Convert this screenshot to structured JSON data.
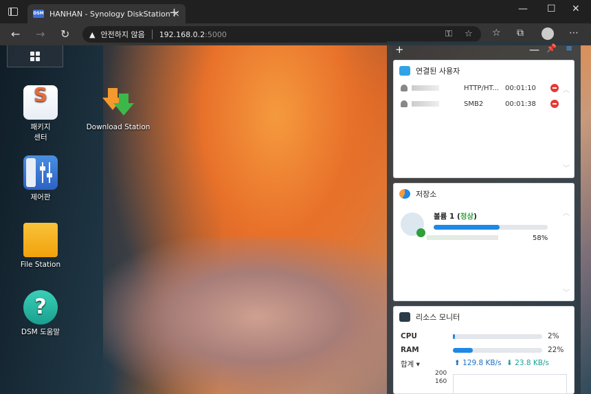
{
  "browser": {
    "tab_title": "HANHAN - Synology DiskStation",
    "favicon_text": "DSM",
    "security_label": "안전하지 않음",
    "address_host": "192.168.0.2",
    "address_port": ":5000"
  },
  "desktop": {
    "icons": [
      {
        "label": "패키지\n센터",
        "icon": "package-center-icon"
      },
      {
        "label": "Download Station",
        "icon": "download-station-icon"
      },
      {
        "label": "제어판",
        "icon": "control-panel-icon"
      },
      {
        "label": "File Station",
        "icon": "file-station-icon"
      },
      {
        "label": "DSM 도움말",
        "icon": "dsm-help-icon"
      }
    ],
    "icon_labels": {
      "pkg1": "패키지",
      "pkg2": "센터",
      "download": "Download Station",
      "control": "제어판",
      "file": "File Station",
      "help": "DSM 도움말"
    }
  },
  "widgets": {
    "users": {
      "title": "연결된 사용자",
      "rows": [
        {
          "protocol": "HTTP/HT...",
          "time": "00:01:10"
        },
        {
          "protocol": "SMB2",
          "time": "00:01:38"
        }
      ]
    },
    "storage": {
      "title": "저장소",
      "volume_name": "볼륨 1",
      "volume_status": "정상",
      "usage_percent": 58,
      "usage_label": "58%"
    },
    "resource": {
      "title": "리소스 모니터",
      "cpu_label": "CPU",
      "cpu_percent": 2,
      "cpu_text": "2%",
      "ram_label": "RAM",
      "ram_percent": 22,
      "ram_text": "22%",
      "total_label": "합계",
      "upload": "129.8 KB/s",
      "download": "23.8 KB/s",
      "chart_tick_200": "200",
      "chart_tick_160": "160"
    }
  },
  "colors": {
    "accent": "#1e88e5",
    "ok": "#2e9f3a",
    "stop": "#e53935"
  }
}
